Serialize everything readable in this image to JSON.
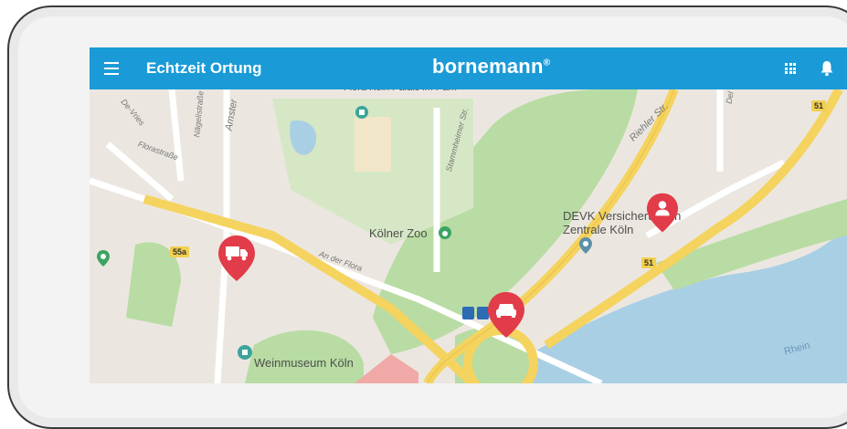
{
  "appbar": {
    "title": "Echtzeit Ortung",
    "brand": "bornemann",
    "brand_mark": "®",
    "menu_icon": "hamburger-icon",
    "apps_icon": "grid-icon",
    "notifications_icon": "bell-icon"
  },
  "map": {
    "places": {
      "flora": "Flora Köln Palais im Park",
      "zoo": "Kölner Zoo",
      "devk_line1": "DEVK Versicherungen",
      "devk_line2": "Zentrale Köln",
      "weinmuseum": "Weinmuseum Köln",
      "rhein": "Rhein"
    },
    "streets": {
      "riehler": "Riehler Str.",
      "amster": "Amster",
      "florastrasse": "Florastraße",
      "an_der_flora": "An der Flora",
      "stammheimer": "Stammheimer Str.",
      "naegelis": "Nägelistraße",
      "de_vries": "De-Vries",
      "dela": "Del"
    },
    "route_shields": [
      "55a",
      "51",
      "51"
    ],
    "markers": [
      {
        "type": "truck",
        "icon": "truck-icon"
      },
      {
        "type": "car",
        "icon": "car-icon"
      },
      {
        "type": "person",
        "icon": "person-icon"
      }
    ],
    "colors": {
      "marker": "#e23b4a",
      "park": "#b8dca3",
      "water": "#a9cfe5",
      "highway": "#f5d35f",
      "appbar": "#1a9bd7"
    }
  }
}
